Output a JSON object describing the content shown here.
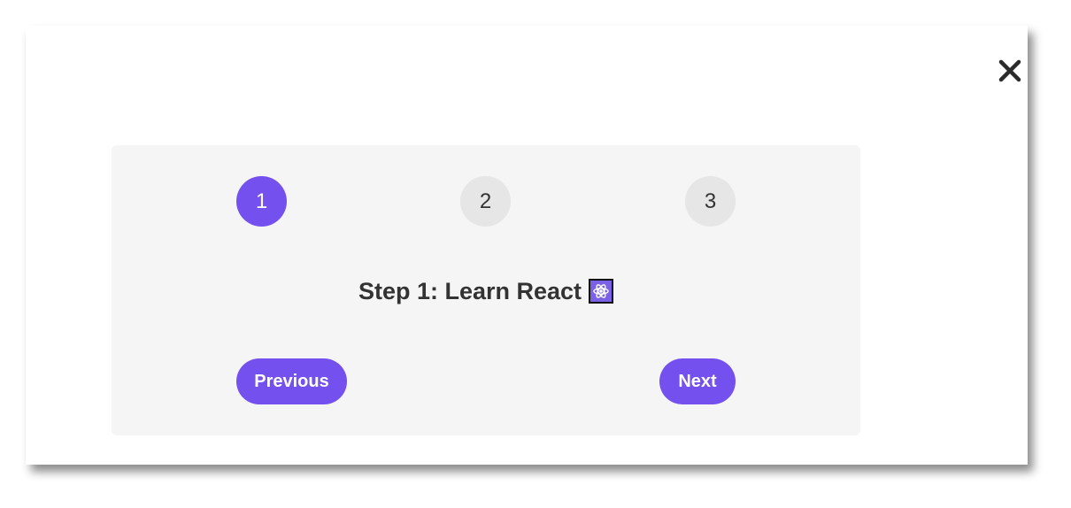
{
  "dialog": {
    "close_icon": "close-icon"
  },
  "stepper": {
    "steps": [
      {
        "label": "1",
        "active": true
      },
      {
        "label": "2",
        "active": false
      },
      {
        "label": "3",
        "active": false
      }
    ],
    "current_title": "Step 1: Learn React",
    "title_icon": "atom-icon",
    "previous_label": "Previous",
    "next_label": "Next"
  },
  "colors": {
    "accent": "#7450ee",
    "inactive_step": "#e6e6e6",
    "card_background": "#f5f5f5",
    "text": "#333333"
  }
}
